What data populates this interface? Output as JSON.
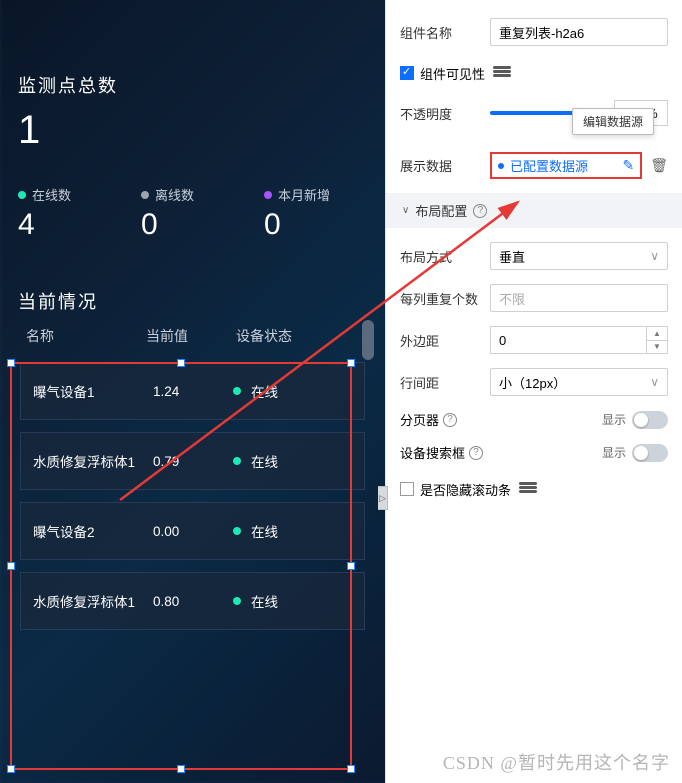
{
  "dashboard": {
    "title": "监测点总数",
    "total": "1",
    "stats": [
      {
        "label": "在线数",
        "value": "4",
        "dot": "green"
      },
      {
        "label": "离线数",
        "value": "0",
        "dot": "gray"
      },
      {
        "label": "本月新增",
        "value": "0",
        "dot": "purple"
      }
    ],
    "section_title": "当前情况",
    "columns": [
      "名称",
      "当前值",
      "设备状态"
    ],
    "rows": [
      {
        "name": "曝气设备1",
        "value": "1.24",
        "status": "在线"
      },
      {
        "name": "水质修复浮标体1",
        "value": "0.79",
        "status": "在线"
      },
      {
        "name": "曝气设备2",
        "value": "0.00",
        "status": "在线"
      },
      {
        "name": "水质修复浮标体1",
        "value": "0.80",
        "status": "在线"
      }
    ]
  },
  "panel": {
    "component_name_label": "组件名称",
    "component_name_value": "重复列表-h2a6",
    "visibility_label": "组件可见性",
    "opacity_label": "不透明度",
    "opacity_value": "100%",
    "tooltip": "编辑数据源",
    "display_data_label": "展示数据",
    "datasrc_configured": "已配置数据源",
    "layout_section": "布局配置",
    "layout_mode_label": "布局方式",
    "layout_mode_value": "垂直",
    "per_col_label": "每列重复个数",
    "per_col_placeholder": "不限",
    "margin_label": "外边距",
    "margin_value": "0",
    "row_gap_label": "行间距",
    "row_gap_value": "小（12px）",
    "pager_label": "分页器",
    "search_label": "设备搜索框",
    "hide_scroll_label": "是否隐藏滚动条",
    "show_text": "显示"
  },
  "watermark": "CSDN @暂时先用这个名字"
}
